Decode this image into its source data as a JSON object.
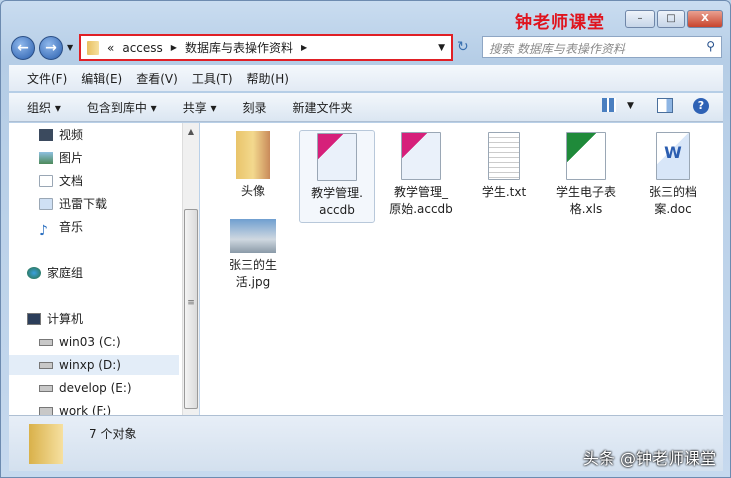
{
  "title_brand": "钟老师课堂",
  "window_buttons": {
    "minimize": "–",
    "maximize": "□",
    "close": "X"
  },
  "address": {
    "prefix": "«",
    "segments": [
      "access",
      "数据库与表操作资料"
    ]
  },
  "search": {
    "placeholder": "搜索 数据库与表操作资料"
  },
  "menu": [
    "文件(F)",
    "编辑(E)",
    "查看(V)",
    "工具(T)",
    "帮助(H)"
  ],
  "toolbar": [
    "组织 ▾",
    "包含到库中 ▾",
    "共享 ▾",
    "刻录",
    "新建文件夹"
  ],
  "sidebar": [
    {
      "label": "视频",
      "icon": "video"
    },
    {
      "label": "图片",
      "icon": "picture"
    },
    {
      "label": "文档",
      "icon": "document"
    },
    {
      "label": "迅雷下载",
      "icon": "download"
    },
    {
      "label": "音乐",
      "icon": "music"
    },
    {
      "label": "家庭组",
      "icon": "homegroup"
    },
    {
      "label": "计算机",
      "icon": "computer"
    },
    {
      "label": "win03 (C:)",
      "icon": "drive"
    },
    {
      "label": "winxp (D:)",
      "icon": "drive"
    },
    {
      "label": "develop (E:)",
      "icon": "drive"
    },
    {
      "label": "work (F:)",
      "icon": "drive"
    }
  ],
  "files": [
    {
      "line1": "头像",
      "line2": "",
      "type": "folder"
    },
    {
      "line1": "教学管理.",
      "line2": "accdb",
      "type": "access"
    },
    {
      "line1": "教学管理_",
      "line2": "原始.accdb",
      "type": "access"
    },
    {
      "line1": "学生.txt",
      "line2": "",
      "type": "text"
    },
    {
      "line1": "学生电子表",
      "line2": "格.xls",
      "type": "excel"
    },
    {
      "line1": "张三的档",
      "line2": "案.doc",
      "type": "word"
    },
    {
      "line1": "张三的生",
      "line2": "活.jpg",
      "type": "image"
    }
  ],
  "status": "7 个对象",
  "watermark": "头条 @钟老师课堂"
}
